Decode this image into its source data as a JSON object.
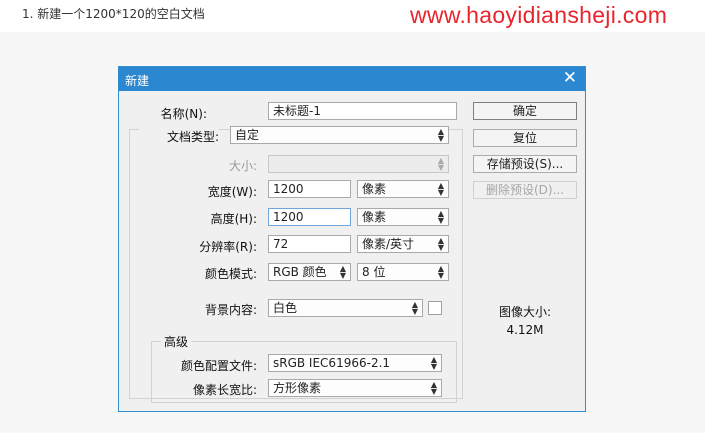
{
  "caption": "1. 新建一个1200*120的空白文档",
  "watermark": "www.haoyidiansheji.com",
  "dialog": {
    "title": "新建",
    "name_label": "名称(N):",
    "name_value": "未标题-1",
    "doctype_label": "文档类型:",
    "doctype_value": "自定",
    "size_label": "大小:",
    "size_value": "",
    "width_label": "宽度(W):",
    "width_value": "1200",
    "width_unit": "像素",
    "height_label": "高度(H):",
    "height_value": "1200",
    "height_unit": "像素",
    "res_label": "分辨率(R):",
    "res_value": "72",
    "res_unit": "像素/英寸",
    "colormode_label": "颜色模式:",
    "colormode_value": "RGB 颜色",
    "bitdepth_value": "8 位",
    "bg_label": "背景内容:",
    "bg_value": "白色",
    "advanced_label": "高级",
    "profile_label": "颜色配置文件:",
    "profile_value": "sRGB IEC61966-2.1",
    "aspect_label": "像素长宽比:",
    "aspect_value": "方形像素",
    "ok_label": "确定",
    "reset_label": "复位",
    "save_preset_label": "存储预设(S)...",
    "delete_preset_label": "删除预设(D)...",
    "image_size_label": "图像大小:",
    "image_size_value": "4.12M"
  },
  "colors": {
    "titlebar": "#2b87cf",
    "watermark": "#e8242d",
    "dialog_bg": "#f0f0f0"
  }
}
